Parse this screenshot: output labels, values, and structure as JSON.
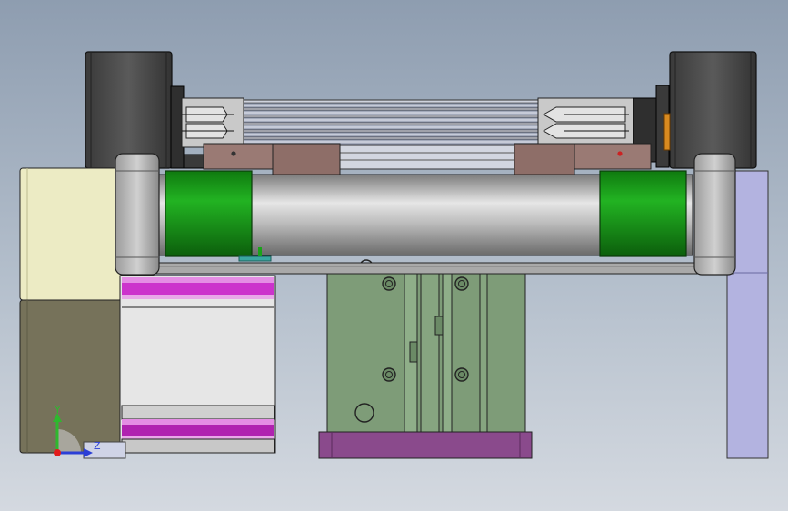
{
  "viewport": {
    "name": "cad-3d-view",
    "background_top": "#8e9db0",
    "background_bottom": "#d4d9e0"
  },
  "triad": {
    "y_label": "Y",
    "z_label": "Z",
    "y_color": "#2eb82e",
    "z_color": "#2b3fd6",
    "x_color": "#e21b1b"
  },
  "colors": {
    "motor_dark": "#4a4a4a",
    "roller_green": "#1aa31a",
    "shaft_steel": "#b3b3b3",
    "bracket_brown": "#9a7a74",
    "cream_block": "#ecebc4",
    "olive_block": "#76725a",
    "magenta_strip": "#cc33cc",
    "slide_green": "#7e9c78",
    "base_purple": "#8a4a8c",
    "lavender_post": "#b3b3e0"
  }
}
